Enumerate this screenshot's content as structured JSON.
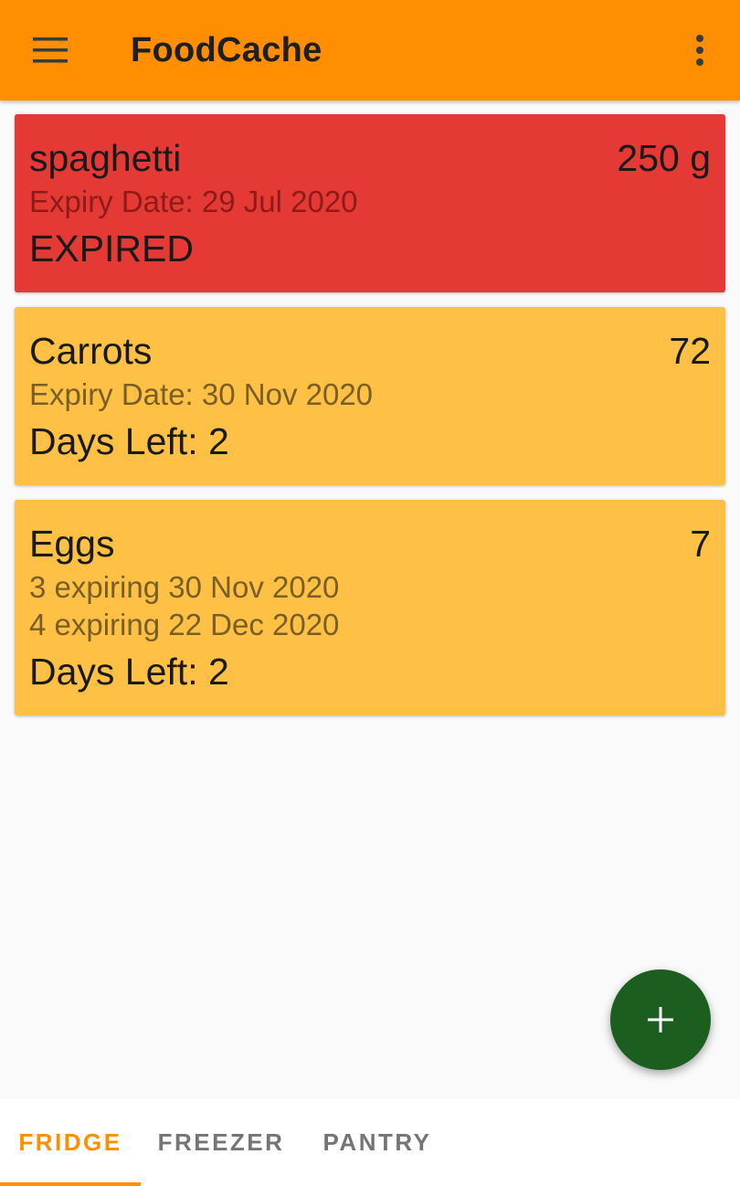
{
  "appbar": {
    "title": "FoodCache",
    "menu_icon": "hamburger-menu-icon",
    "more_icon": "more-vert-icon",
    "color": "#ff8f00"
  },
  "items": [
    {
      "name": "spaghetti",
      "quantity": "250 g",
      "details": [
        "Expiry Date: 29 Jul 2020"
      ],
      "status": "EXPIRED",
      "color": "#e53935"
    },
    {
      "name": "Carrots",
      "quantity": "72",
      "details": [
        "Expiry Date: 30 Nov 2020"
      ],
      "status": "Days Left: 2",
      "color": "#ffc145"
    },
    {
      "name": "Eggs",
      "quantity": "7",
      "details": [
        "3 expiring 30 Nov 2020",
        "4 expiring 22 Dec 2020"
      ],
      "status": "Days Left: 2",
      "color": "#ffc145"
    }
  ],
  "fab": {
    "icon": "plus-icon",
    "color": "#1b5e20"
  },
  "tabs": [
    {
      "label": "FRIDGE",
      "active": true
    },
    {
      "label": "FREEZER",
      "active": false
    },
    {
      "label": "PANTRY",
      "active": false
    }
  ],
  "accent_color": "#ff8f00"
}
